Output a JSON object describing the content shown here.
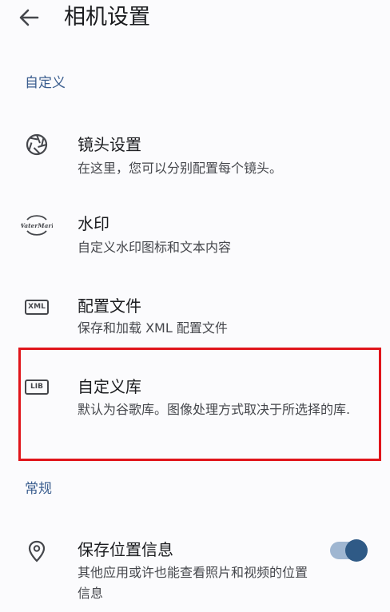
{
  "header": {
    "title": "相机设置",
    "back_icon": "arrow-back-icon"
  },
  "sections": {
    "custom": "自定义",
    "general": "常规"
  },
  "rows": {
    "lens": {
      "title": "镜头设置",
      "subtitle": "在这里，您可以分别配置每个镜头。",
      "icon": "aperture-icon"
    },
    "watermark": {
      "title": "水印",
      "subtitle": "自定义水印图标和文本内容",
      "icon": "watermark-icon",
      "icon_text": "WaterMark"
    },
    "config": {
      "title": "配置文件",
      "subtitle": "保存和加载 XML 配置文件",
      "icon": "xml-icon",
      "icon_text": "XML"
    },
    "library": {
      "title": "自定义库",
      "subtitle": "默认为谷歌库。图像处理方式取决于所选择的库.",
      "icon": "lib-icon",
      "icon_text": "LIB"
    },
    "location": {
      "title": "保存位置信息",
      "subtitle": "其他应用或许也能查看照片和视频的位置信息",
      "icon": "location-pin-icon",
      "enabled": true
    }
  },
  "colors": {
    "accent": "#3b5e8f",
    "highlight": "#e0151b",
    "toggle_track": "#9fb6d1",
    "toggle_thumb": "#2f5a86"
  }
}
